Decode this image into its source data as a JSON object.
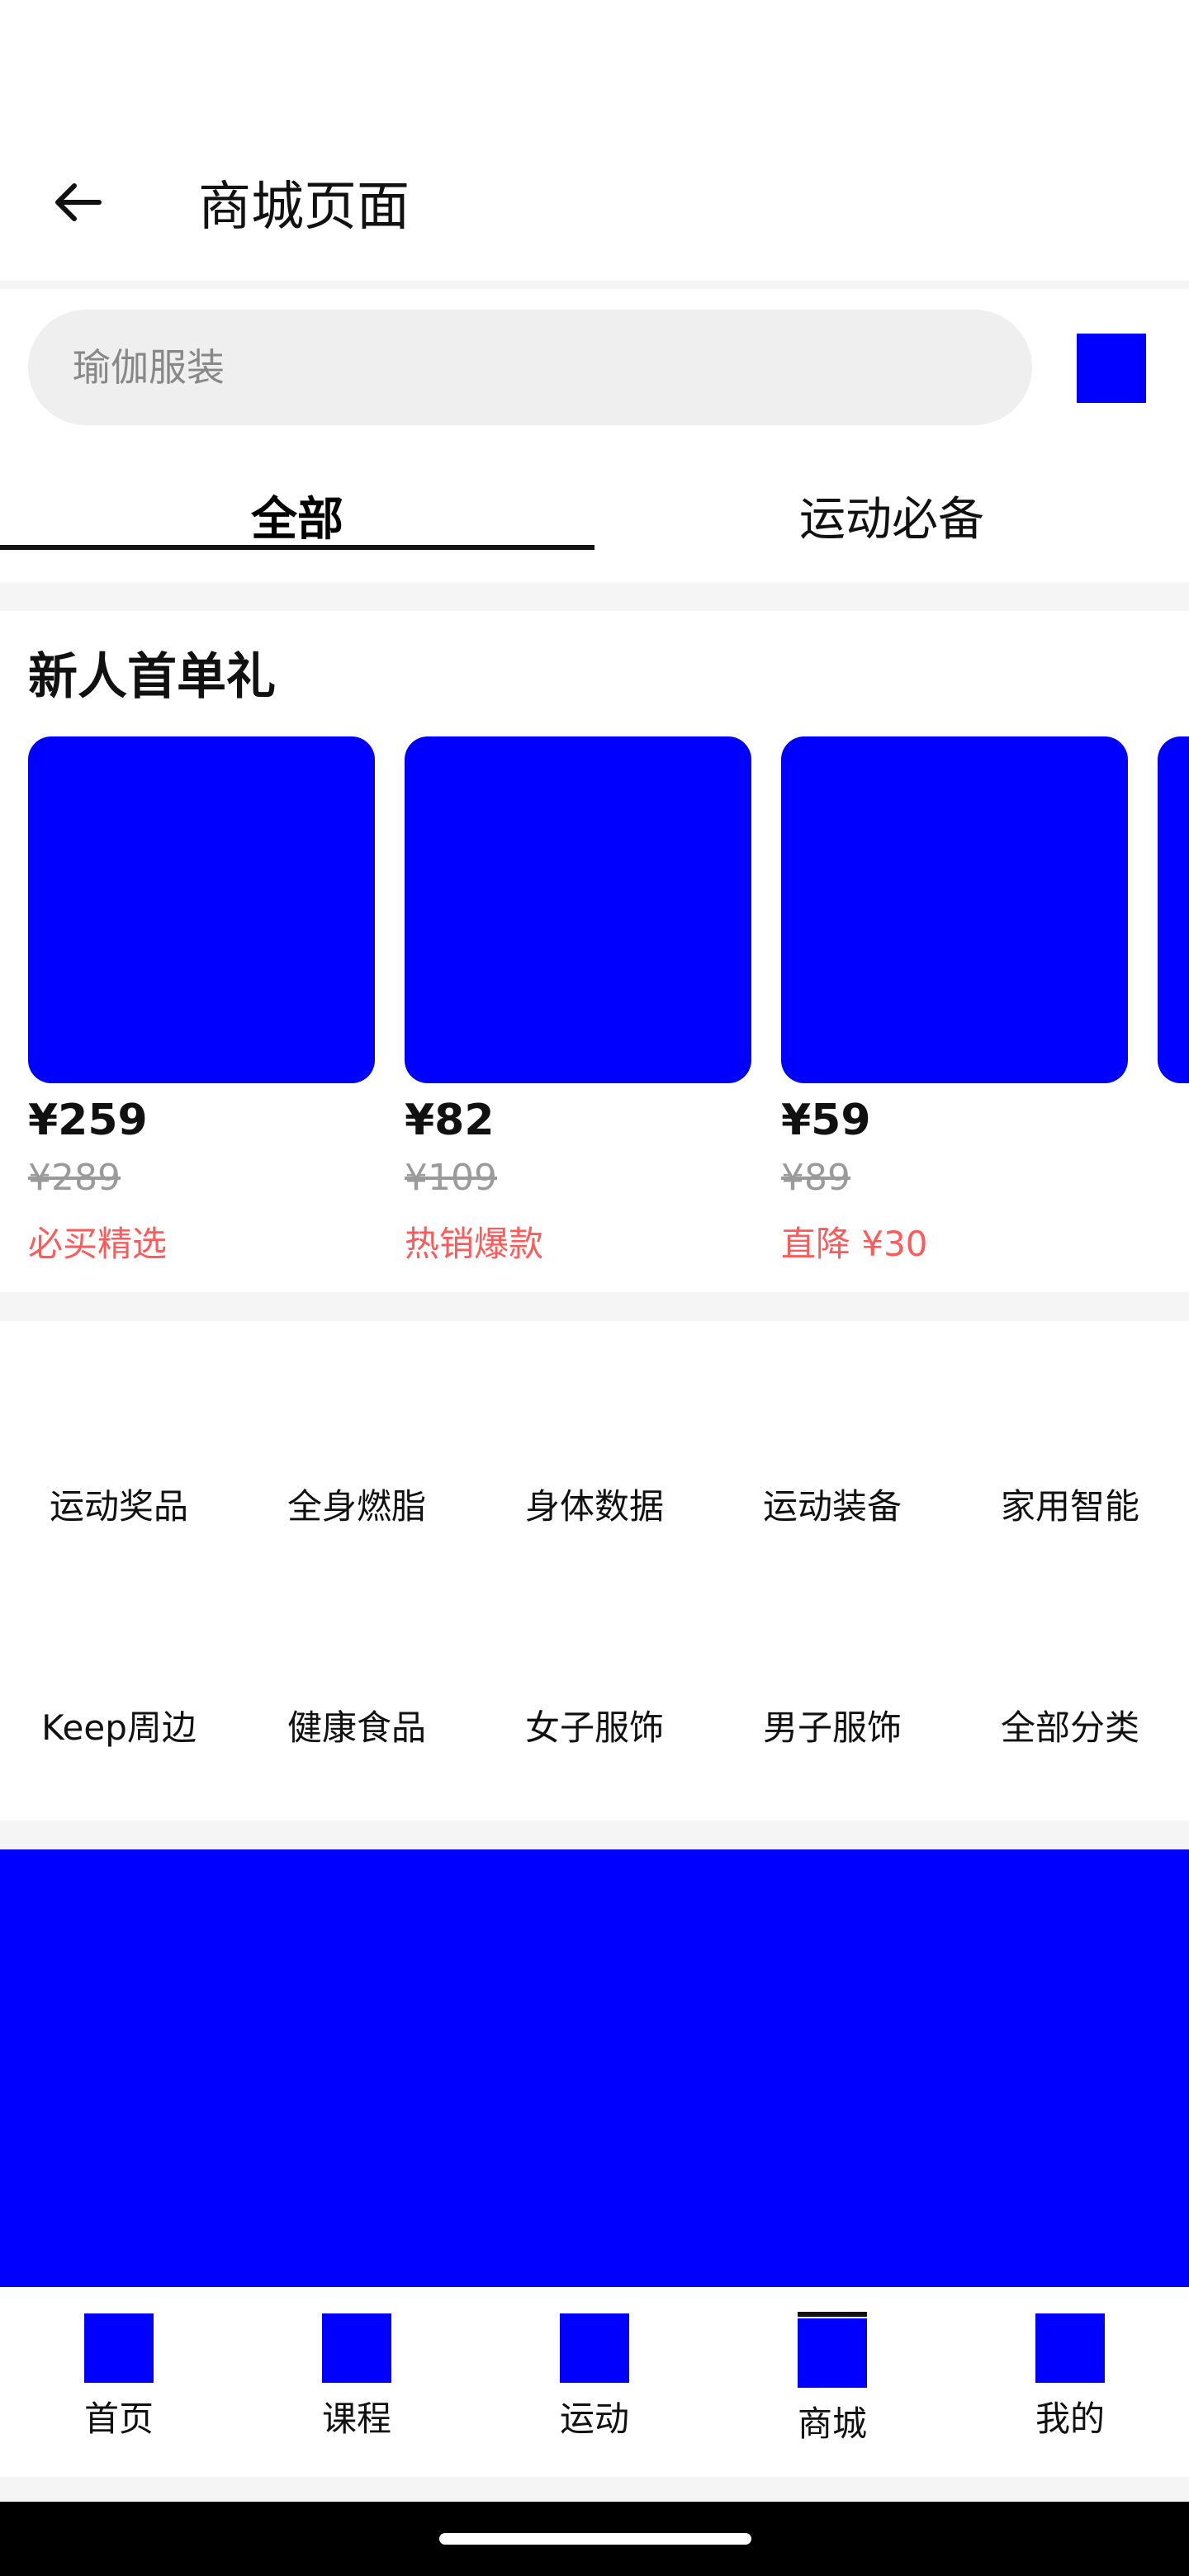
{
  "header": {
    "title": "商城页面"
  },
  "search": {
    "placeholder": "瑜伽服装"
  },
  "tabs": [
    {
      "label": "全部",
      "active": true
    },
    {
      "label": "运动必备",
      "active": false
    }
  ],
  "new_user_section": {
    "title": "新人首单礼",
    "products": [
      {
        "price": "¥259",
        "original_price": "¥289",
        "tag": "必买精选"
      },
      {
        "price": "¥82",
        "original_price": "¥109",
        "tag": "热销爆款"
      },
      {
        "price": "¥59",
        "original_price": "¥89",
        "tag": "直降 ¥30"
      }
    ]
  },
  "categories": [
    "运动奖品",
    "全身燃脂",
    "身体数据",
    "运动装备",
    "家用智能",
    "Keep周边",
    "健康食品",
    "女子服饰",
    "男子服饰",
    "全部分类"
  ],
  "bottom_nav": [
    {
      "label": "首页",
      "active": false
    },
    {
      "label": "课程",
      "active": false
    },
    {
      "label": "运动",
      "active": false
    },
    {
      "label": "商城",
      "active": true
    },
    {
      "label": "我的",
      "active": false
    }
  ],
  "colors": {
    "accent_placeholder": "#0000ff",
    "promo_tag": "#ff5a5a",
    "original_price": "#9a9a9a",
    "search_bg": "#efefef",
    "page_bg": "#f5f5f5"
  },
  "icons": {
    "back": "arrow-left-icon",
    "search_action": "placeholder-icon"
  }
}
